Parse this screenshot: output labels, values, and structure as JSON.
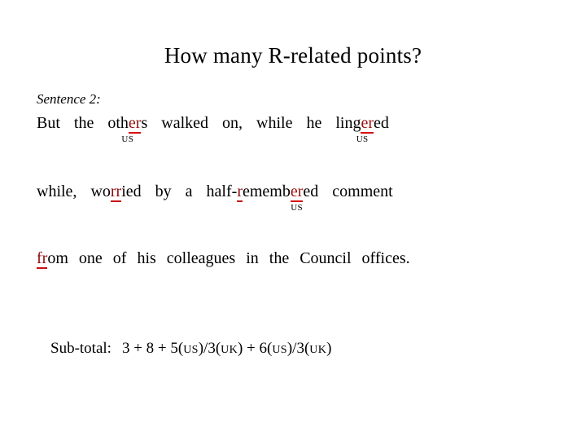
{
  "slide": {
    "title": "How many R-related points?",
    "background_color": "#ffffff",
    "text_color": "#000000",
    "mark_color": "#9c0f0f",
    "underline_color": "#d51010"
  },
  "sentence_label": "Sentence 2:",
  "lines": [
    {
      "id": "line-1",
      "plain_text": "But the others walked on, while he lingered",
      "tokens": [
        {
          "text": "But"
        },
        {
          "text": "the"
        },
        {
          "pre": "oth",
          "mark": "er",
          "post": "s",
          "annot": "US"
        },
        {
          "text": "walked"
        },
        {
          "text": "on,"
        },
        {
          "text": "while"
        },
        {
          "text": "he"
        },
        {
          "pre": "ling",
          "mark": "er",
          "post": "ed",
          "annot": "US"
        }
      ]
    },
    {
      "id": "line-2",
      "plain_text": "while, worried by a half-remembered comment",
      "tokens": [
        {
          "text": "while,"
        },
        {
          "pre": "wo",
          "mark": "rr",
          "post": "ied",
          "annot": ""
        },
        {
          "text": "by"
        },
        {
          "text": "a"
        },
        {
          "pre": "half-",
          "mark": "r",
          "post": "emembered",
          "annot": ""
        },
        {
          "text": "comment"
        }
      ]
    },
    {
      "id": "line-3",
      "plain_text": "from one of his colleagues in the Council offices.",
      "tokens": [
        {
          "pre": "",
          "mark": "fr",
          "post": "om",
          "annot": ""
        },
        {
          "text": "one"
        },
        {
          "text": "of"
        },
        {
          "text": "his"
        },
        {
          "text": "colleagues"
        },
        {
          "text": "in"
        },
        {
          "text": "the"
        },
        {
          "text": "Council"
        },
        {
          "text": "offices."
        }
      ]
    }
  ],
  "line1": {
    "w_but": "But",
    "w_the": "the",
    "others_pre": "oth",
    "others_mark": "er",
    "others_post": "s",
    "others_annot": "US",
    "w_walked": "walked",
    "w_on": "on,",
    "w_while": "while",
    "w_he": "he",
    "lingered_pre": "ling",
    "lingered_mark": "er",
    "lingered_post": "ed",
    "lingered_annot": "US"
  },
  "line2": {
    "w_while": "while,",
    "worried_pre": "wo",
    "worried_mark": "rr",
    "worried_post": "ied",
    "w_by": "by",
    "w_a": "a",
    "half_pre": "half-",
    "half_mark": "r",
    "half_mid": "ememb",
    "half_mark2": "er",
    "half_post": "ed",
    "half_annot": "US",
    "w_comment": "comment"
  },
  "line3": {
    "from_mark": "fr",
    "from_post": "om",
    "w_one": "one",
    "w_of": "of",
    "w_his": "his",
    "w_colleagues": "colleagues",
    "w_in": "in",
    "w_the": "the",
    "w_council": "Council",
    "w_offices": "offices."
  },
  "subtotal": {
    "label": "Sub-total:",
    "expr_a": "3 + 8 + 5(",
    "sc_us_1": "us",
    "expr_b": ")/3(",
    "sc_uk_1": "uk",
    "expr_c": ") + 6(",
    "sc_us_2": "us",
    "expr_d": ")/3(",
    "sc_uk_2": "uk",
    "expr_e": ")",
    "full_text": "Sub-total: 3 + 8 + 5(US)/3(UK) + 6(US)/3(UK)"
  }
}
